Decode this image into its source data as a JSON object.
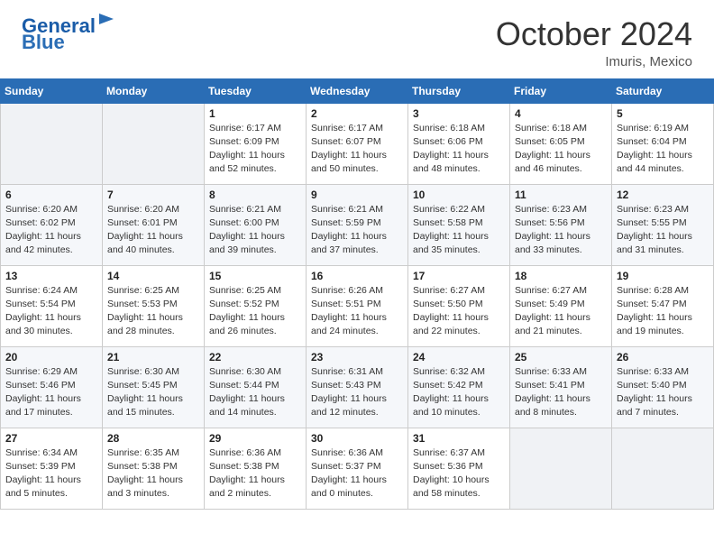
{
  "header": {
    "logo_line1": "General",
    "logo_line2": "Blue",
    "month_title": "October 2024",
    "location": "Imuris, Mexico"
  },
  "weekdays": [
    "Sunday",
    "Monday",
    "Tuesday",
    "Wednesday",
    "Thursday",
    "Friday",
    "Saturday"
  ],
  "weeks": [
    [
      {
        "day": "",
        "info": ""
      },
      {
        "day": "",
        "info": ""
      },
      {
        "day": "1",
        "info": "Sunrise: 6:17 AM\nSunset: 6:09 PM\nDaylight: 11 hours and 52 minutes."
      },
      {
        "day": "2",
        "info": "Sunrise: 6:17 AM\nSunset: 6:07 PM\nDaylight: 11 hours and 50 minutes."
      },
      {
        "day": "3",
        "info": "Sunrise: 6:18 AM\nSunset: 6:06 PM\nDaylight: 11 hours and 48 minutes."
      },
      {
        "day": "4",
        "info": "Sunrise: 6:18 AM\nSunset: 6:05 PM\nDaylight: 11 hours and 46 minutes."
      },
      {
        "day": "5",
        "info": "Sunrise: 6:19 AM\nSunset: 6:04 PM\nDaylight: 11 hours and 44 minutes."
      }
    ],
    [
      {
        "day": "6",
        "info": "Sunrise: 6:20 AM\nSunset: 6:02 PM\nDaylight: 11 hours and 42 minutes."
      },
      {
        "day": "7",
        "info": "Sunrise: 6:20 AM\nSunset: 6:01 PM\nDaylight: 11 hours and 40 minutes."
      },
      {
        "day": "8",
        "info": "Sunrise: 6:21 AM\nSunset: 6:00 PM\nDaylight: 11 hours and 39 minutes."
      },
      {
        "day": "9",
        "info": "Sunrise: 6:21 AM\nSunset: 5:59 PM\nDaylight: 11 hours and 37 minutes."
      },
      {
        "day": "10",
        "info": "Sunrise: 6:22 AM\nSunset: 5:58 PM\nDaylight: 11 hours and 35 minutes."
      },
      {
        "day": "11",
        "info": "Sunrise: 6:23 AM\nSunset: 5:56 PM\nDaylight: 11 hours and 33 minutes."
      },
      {
        "day": "12",
        "info": "Sunrise: 6:23 AM\nSunset: 5:55 PM\nDaylight: 11 hours and 31 minutes."
      }
    ],
    [
      {
        "day": "13",
        "info": "Sunrise: 6:24 AM\nSunset: 5:54 PM\nDaylight: 11 hours and 30 minutes."
      },
      {
        "day": "14",
        "info": "Sunrise: 6:25 AM\nSunset: 5:53 PM\nDaylight: 11 hours and 28 minutes."
      },
      {
        "day": "15",
        "info": "Sunrise: 6:25 AM\nSunset: 5:52 PM\nDaylight: 11 hours and 26 minutes."
      },
      {
        "day": "16",
        "info": "Sunrise: 6:26 AM\nSunset: 5:51 PM\nDaylight: 11 hours and 24 minutes."
      },
      {
        "day": "17",
        "info": "Sunrise: 6:27 AM\nSunset: 5:50 PM\nDaylight: 11 hours and 22 minutes."
      },
      {
        "day": "18",
        "info": "Sunrise: 6:27 AM\nSunset: 5:49 PM\nDaylight: 11 hours and 21 minutes."
      },
      {
        "day": "19",
        "info": "Sunrise: 6:28 AM\nSunset: 5:47 PM\nDaylight: 11 hours and 19 minutes."
      }
    ],
    [
      {
        "day": "20",
        "info": "Sunrise: 6:29 AM\nSunset: 5:46 PM\nDaylight: 11 hours and 17 minutes."
      },
      {
        "day": "21",
        "info": "Sunrise: 6:30 AM\nSunset: 5:45 PM\nDaylight: 11 hours and 15 minutes."
      },
      {
        "day": "22",
        "info": "Sunrise: 6:30 AM\nSunset: 5:44 PM\nDaylight: 11 hours and 14 minutes."
      },
      {
        "day": "23",
        "info": "Sunrise: 6:31 AM\nSunset: 5:43 PM\nDaylight: 11 hours and 12 minutes."
      },
      {
        "day": "24",
        "info": "Sunrise: 6:32 AM\nSunset: 5:42 PM\nDaylight: 11 hours and 10 minutes."
      },
      {
        "day": "25",
        "info": "Sunrise: 6:33 AM\nSunset: 5:41 PM\nDaylight: 11 hours and 8 minutes."
      },
      {
        "day": "26",
        "info": "Sunrise: 6:33 AM\nSunset: 5:40 PM\nDaylight: 11 hours and 7 minutes."
      }
    ],
    [
      {
        "day": "27",
        "info": "Sunrise: 6:34 AM\nSunset: 5:39 PM\nDaylight: 11 hours and 5 minutes."
      },
      {
        "day": "28",
        "info": "Sunrise: 6:35 AM\nSunset: 5:38 PM\nDaylight: 11 hours and 3 minutes."
      },
      {
        "day": "29",
        "info": "Sunrise: 6:36 AM\nSunset: 5:38 PM\nDaylight: 11 hours and 2 minutes."
      },
      {
        "day": "30",
        "info": "Sunrise: 6:36 AM\nSunset: 5:37 PM\nDaylight: 11 hours and 0 minutes."
      },
      {
        "day": "31",
        "info": "Sunrise: 6:37 AM\nSunset: 5:36 PM\nDaylight: 10 hours and 58 minutes."
      },
      {
        "day": "",
        "info": ""
      },
      {
        "day": "",
        "info": ""
      }
    ]
  ]
}
